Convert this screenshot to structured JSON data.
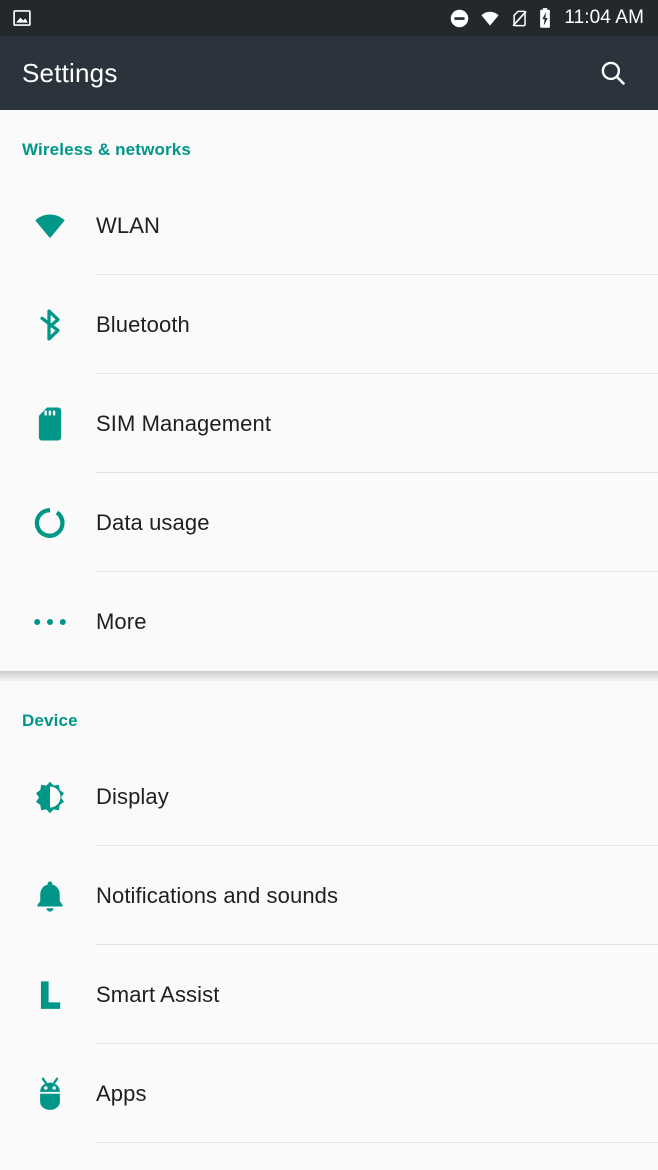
{
  "theme": {
    "accent": "#009688",
    "statusbar_bg": "#23282d",
    "appbar_bg": "#2b343c",
    "page_bg": "#fafafa",
    "divider": "#e4e4e4",
    "label_color": "#1f1f1f"
  },
  "statusbar": {
    "time": "11:04 AM",
    "left_icons": [
      {
        "name": "screenshot-image-icon",
        "label": "Screenshot captured"
      }
    ],
    "right_icons": [
      {
        "name": "do-not-disturb-icon",
        "label": "Do not disturb"
      },
      {
        "name": "wifi-icon",
        "label": "Wi-Fi connected"
      },
      {
        "name": "no-sim-card-icon",
        "label": "No SIM card"
      },
      {
        "name": "battery-charging-icon",
        "label": "Battery charging"
      }
    ]
  },
  "appbar": {
    "title": "Settings",
    "search_label": "Search",
    "search_icon": "search-icon"
  },
  "groups": [
    {
      "id": "wireless-and-networks",
      "header": "Wireless & networks",
      "items": [
        {
          "id": "wlan",
          "label": "WLAN",
          "icon": "wifi-icon"
        },
        {
          "id": "bluetooth",
          "label": "Bluetooth",
          "icon": "bluetooth-icon"
        },
        {
          "id": "sim-management",
          "label": "SIM Management",
          "icon": "sim-card-icon"
        },
        {
          "id": "data-usage",
          "label": "Data usage",
          "icon": "data-usage-icon"
        },
        {
          "id": "more",
          "label": "More",
          "icon": "more-horizontal-icon"
        }
      ]
    },
    {
      "id": "device",
      "header": "Device",
      "items": [
        {
          "id": "display",
          "label": "Display",
          "icon": "brightness-icon"
        },
        {
          "id": "notifications-and-sounds",
          "label": "Notifications and sounds",
          "icon": "bell-icon"
        },
        {
          "id": "smart-assist",
          "label": "Smart Assist",
          "icon": "smart-assist-icon"
        },
        {
          "id": "apps",
          "label": "Apps",
          "icon": "android-robot-icon"
        }
      ]
    }
  ]
}
